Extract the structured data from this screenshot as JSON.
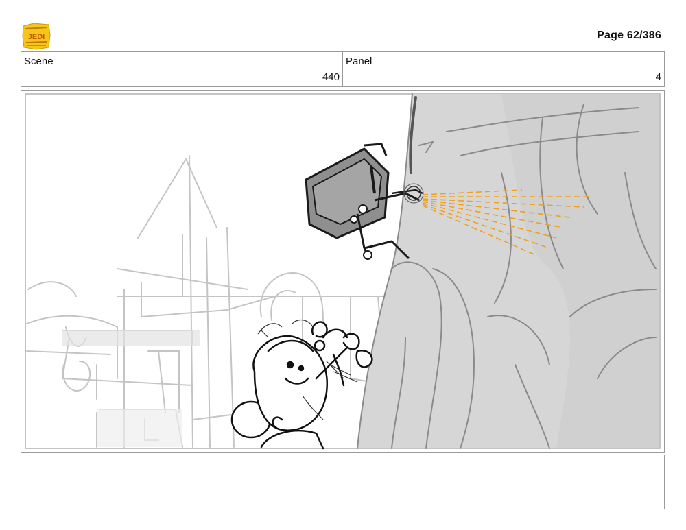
{
  "header": {
    "logo_text": "YOUNG JEDI ADVENTURES",
    "page_number": "Page  62/386"
  },
  "info": {
    "scene_label": "Scene",
    "scene_value": "440",
    "panel_label": "Panel",
    "panel_value": "4"
  },
  "artwork": {
    "description_icon": "storyboard-sketch"
  },
  "notes": {
    "text": ""
  },
  "colors": {
    "accent_orange": "#f0a020",
    "logo_yellow": "#f5c518",
    "sketch_gray": "#9a9a9a",
    "rock_fill": "#d6d6d6"
  }
}
